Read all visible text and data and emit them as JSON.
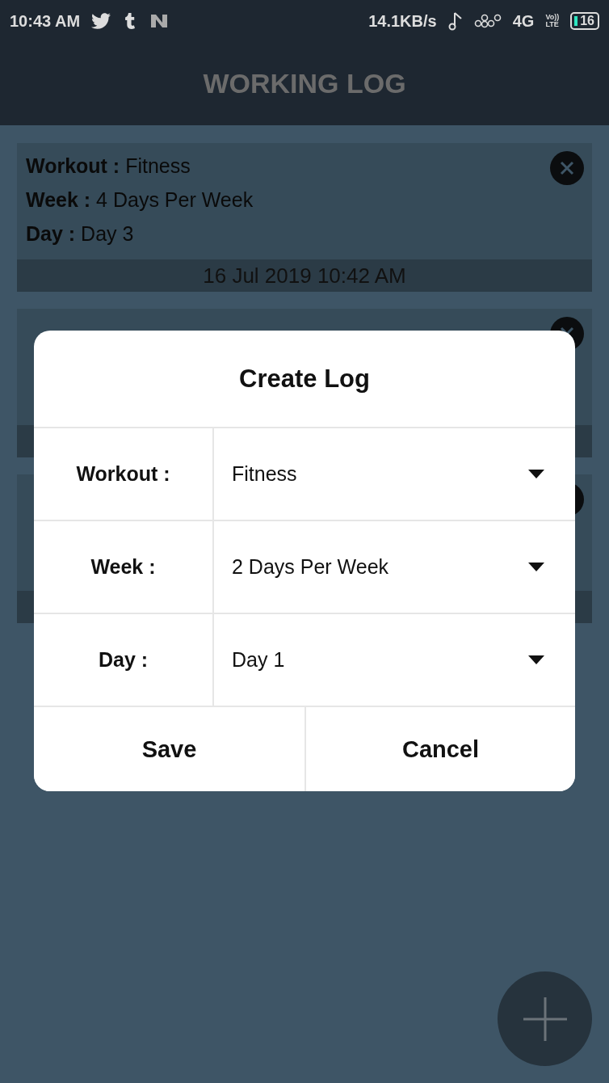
{
  "status_bar": {
    "time": "10:43 AM",
    "speed": "14.1KB/s",
    "network": "4G",
    "volte": [
      "Vo))",
      "LTE"
    ],
    "battery": "16"
  },
  "header": {
    "title": "WORKING LOG"
  },
  "logs": [
    {
      "kind": "full",
      "fields": [
        {
          "label": "Workout :",
          "value": "Fitness"
        },
        {
          "label": "Week :",
          "value": "4 Days Per Week"
        },
        {
          "label": "Day :",
          "value": "Day 3"
        }
      ],
      "timestamp": "16 Jul 2019 10:42 AM"
    },
    {
      "kind": "covered"
    },
    {
      "kind": "covered"
    }
  ],
  "dialog": {
    "title": "Create Log",
    "rows": [
      {
        "label": "Workout :",
        "value": "Fitness"
      },
      {
        "label": "Week :",
        "value": "2 Days Per Week"
      },
      {
        "label": "Day :",
        "value": "Day 1"
      }
    ],
    "buttons": [
      "Save",
      "Cancel"
    ]
  }
}
